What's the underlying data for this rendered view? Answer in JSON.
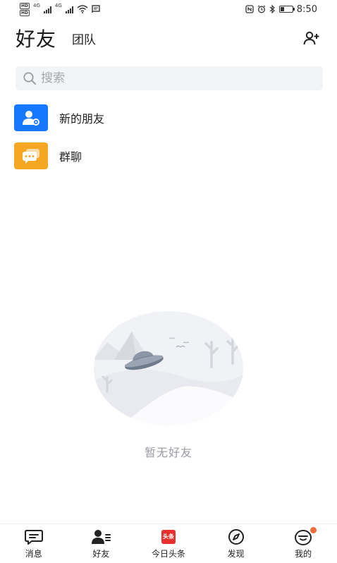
{
  "status_bar": {
    "time": "8:50",
    "hd1": "HD",
    "hd2": "HD",
    "signal_label_1": "4G",
    "signal_label_2": "4G",
    "battery_level": 0.35
  },
  "header": {
    "title": "好友",
    "tab_team": "团队"
  },
  "search": {
    "placeholder": "搜索"
  },
  "list": [
    {
      "label": "新的朋友",
      "icon": "person-add-icon",
      "color": "#1677ff"
    },
    {
      "label": "群聊",
      "icon": "chat-bubble-icon",
      "color": "#f5a623"
    }
  ],
  "empty_state": {
    "text": "暂无好友"
  },
  "bottom_nav": [
    {
      "label": "消息",
      "icon": "message-icon"
    },
    {
      "label": "好友",
      "icon": "friends-icon"
    },
    {
      "label": "今日头条",
      "icon": "toutiao-icon",
      "logo_text": "头条"
    },
    {
      "label": "发现",
      "icon": "compass-icon"
    },
    {
      "label": "我的",
      "icon": "profile-icon"
    }
  ],
  "colors": {
    "accent_blue": "#1677ff",
    "accent_orange": "#f5a623",
    "badge": "#f26b3a",
    "toutiao_red": "#e8302e"
  }
}
